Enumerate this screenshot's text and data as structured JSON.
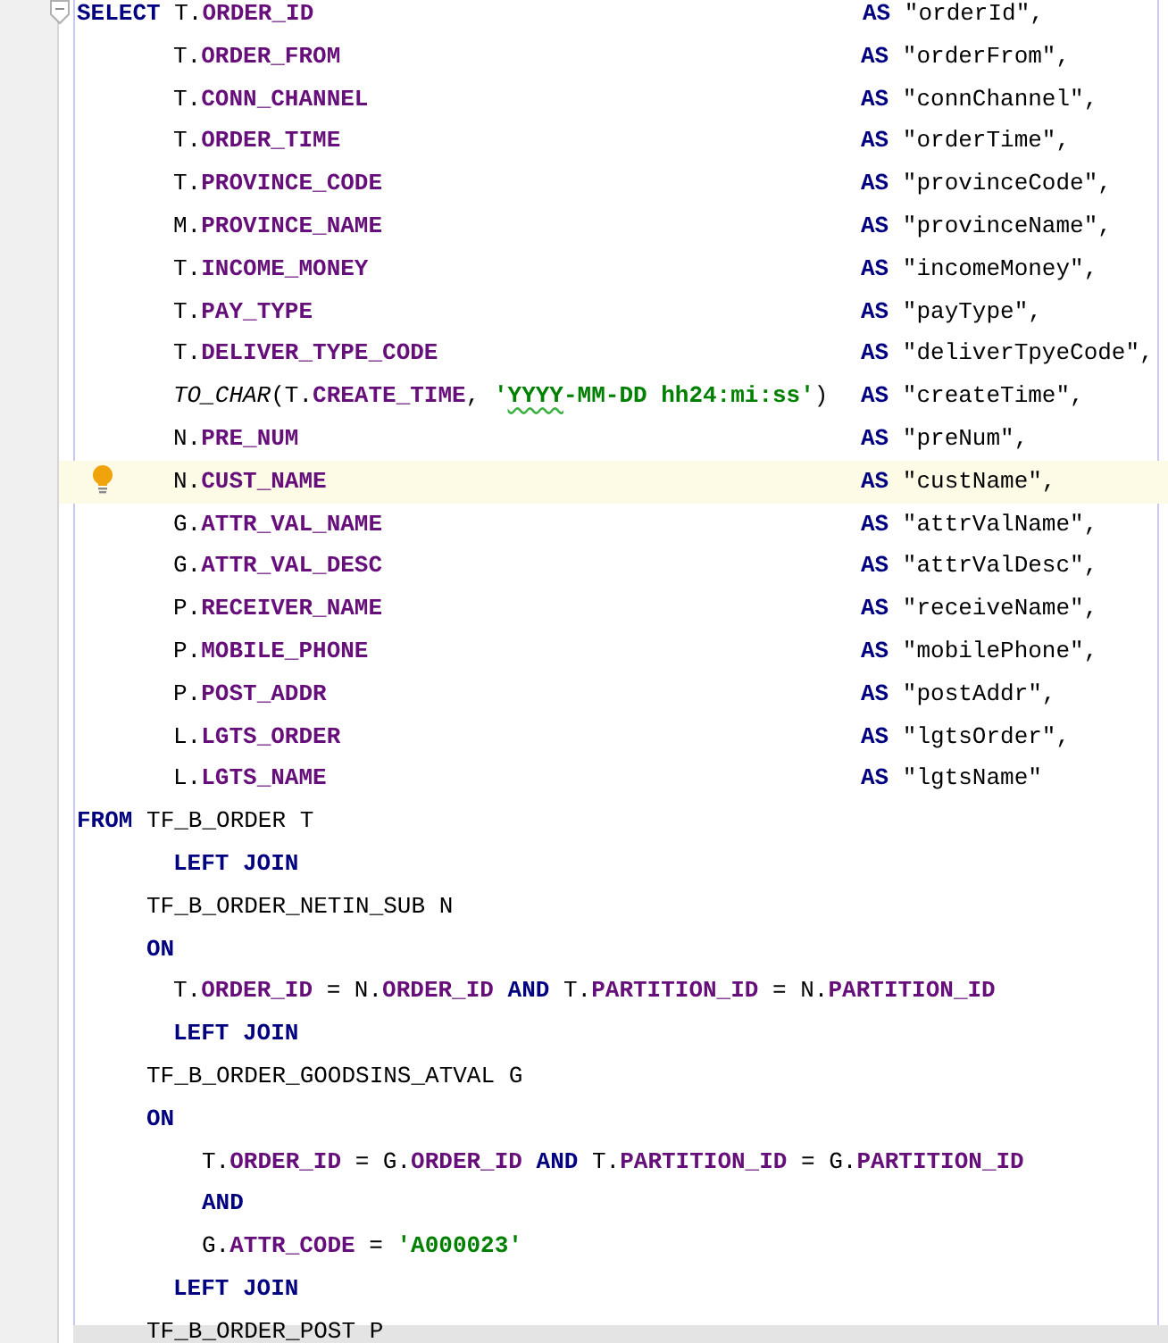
{
  "editor": {
    "lines": [
      {
        "kind": "clause",
        "fold": true,
        "current": false,
        "tokens": [
          {
            "t": "SELECT",
            "kind": "kw"
          },
          {
            "t": " T.",
            "kind": "plain"
          },
          {
            "t": "ORDER_ID",
            "kind": "col"
          }
        ],
        "alias": [
          {
            "t": "AS",
            "kind": "kw"
          },
          {
            "t": " \"orderId\",",
            "kind": "plain"
          }
        ]
      },
      {
        "kind": "column",
        "fold": false,
        "current": false,
        "tokens": [
          {
            "t": "T.",
            "kind": "plain"
          },
          {
            "t": "ORDER_FROM",
            "kind": "col"
          }
        ],
        "alias": [
          {
            "t": "AS",
            "kind": "kw"
          },
          {
            "t": " \"orderFrom\",",
            "kind": "plain"
          }
        ]
      },
      {
        "kind": "column",
        "fold": false,
        "current": false,
        "tokens": [
          {
            "t": "T.",
            "kind": "plain"
          },
          {
            "t": "CONN_CHANNEL",
            "kind": "col"
          }
        ],
        "alias": [
          {
            "t": "AS",
            "kind": "kw"
          },
          {
            "t": " \"connChannel\",",
            "kind": "plain"
          }
        ]
      },
      {
        "kind": "column",
        "fold": false,
        "current": false,
        "tokens": [
          {
            "t": "T.",
            "kind": "plain"
          },
          {
            "t": "ORDER_TIME",
            "kind": "col"
          }
        ],
        "alias": [
          {
            "t": "AS",
            "kind": "kw"
          },
          {
            "t": " \"orderTime\",",
            "kind": "plain"
          }
        ]
      },
      {
        "kind": "column",
        "fold": false,
        "current": false,
        "tokens": [
          {
            "t": "T.",
            "kind": "plain"
          },
          {
            "t": "PROVINCE_CODE",
            "kind": "col"
          }
        ],
        "alias": [
          {
            "t": "AS",
            "kind": "kw"
          },
          {
            "t": " \"provinceCode\",",
            "kind": "plain"
          }
        ]
      },
      {
        "kind": "column",
        "fold": false,
        "current": false,
        "tokens": [
          {
            "t": "M.",
            "kind": "plain"
          },
          {
            "t": "PROVINCE_NAME",
            "kind": "col"
          }
        ],
        "alias": [
          {
            "t": "AS",
            "kind": "kw"
          },
          {
            "t": " \"provinceName\",",
            "kind": "plain"
          }
        ]
      },
      {
        "kind": "column",
        "fold": false,
        "current": false,
        "tokens": [
          {
            "t": "T.",
            "kind": "plain"
          },
          {
            "t": "INCOME_MONEY",
            "kind": "col"
          }
        ],
        "alias": [
          {
            "t": "AS",
            "kind": "kw"
          },
          {
            "t": " \"incomeMoney\",",
            "kind": "plain"
          }
        ]
      },
      {
        "kind": "column",
        "fold": false,
        "current": false,
        "tokens": [
          {
            "t": "T.",
            "kind": "plain"
          },
          {
            "t": "PAY_TYPE",
            "kind": "col"
          }
        ],
        "alias": [
          {
            "t": "AS",
            "kind": "kw"
          },
          {
            "t": " \"payType\",",
            "kind": "plain"
          }
        ]
      },
      {
        "kind": "column",
        "fold": false,
        "current": false,
        "tokens": [
          {
            "t": "T.",
            "kind": "plain"
          },
          {
            "t": "DELIVER_TYPE_CODE",
            "kind": "col"
          }
        ],
        "alias": [
          {
            "t": "AS",
            "kind": "kw"
          },
          {
            "t": " \"deliverTpyeCode\",",
            "kind": "plain"
          }
        ]
      },
      {
        "kind": "column",
        "fold": false,
        "current": false,
        "tokens": [
          {
            "t": "TO_CHAR",
            "kind": "fn"
          },
          {
            "t": "(T.",
            "kind": "plain"
          },
          {
            "t": "CREATE_TIME",
            "kind": "col"
          },
          {
            "t": ", ",
            "kind": "plain"
          },
          {
            "t": "'",
            "kind": "str"
          },
          {
            "t": "YYYY",
            "kind": "str",
            "typo": true
          },
          {
            "t": "-MM-DD hh24:mi:ss'",
            "kind": "str"
          },
          {
            "t": ")",
            "kind": "plain"
          }
        ],
        "alias": [
          {
            "t": "AS",
            "kind": "kw"
          },
          {
            "t": " \"createTime\",",
            "kind": "plain"
          }
        ]
      },
      {
        "kind": "column",
        "fold": false,
        "current": false,
        "tokens": [
          {
            "t": "N.",
            "kind": "plain"
          },
          {
            "t": "PRE_NUM",
            "kind": "col"
          }
        ],
        "alias": [
          {
            "t": "AS",
            "kind": "kw"
          },
          {
            "t": " \"preNum\",",
            "kind": "plain"
          }
        ]
      },
      {
        "kind": "column",
        "fold": false,
        "current": true,
        "tokens": [
          {
            "t": "N.",
            "kind": "plain"
          },
          {
            "t": "CUST_NAME",
            "kind": "col"
          }
        ],
        "alias": [
          {
            "t": "AS",
            "kind": "kw"
          },
          {
            "t": " \"custName\",",
            "kind": "plain"
          }
        ]
      },
      {
        "kind": "column",
        "fold": false,
        "current": false,
        "tokens": [
          {
            "t": "G.",
            "kind": "plain"
          },
          {
            "t": "ATTR_VAL_NAME",
            "kind": "col"
          }
        ],
        "alias": [
          {
            "t": "AS",
            "kind": "kw"
          },
          {
            "t": " \"attrValName\",",
            "kind": "plain"
          }
        ]
      },
      {
        "kind": "column",
        "fold": false,
        "current": false,
        "tokens": [
          {
            "t": "G.",
            "kind": "plain"
          },
          {
            "t": "ATTR_VAL_DESC",
            "kind": "col"
          }
        ],
        "alias": [
          {
            "t": "AS",
            "kind": "kw"
          },
          {
            "t": " \"attrValDesc\",",
            "kind": "plain"
          }
        ]
      },
      {
        "kind": "column",
        "fold": false,
        "current": false,
        "tokens": [
          {
            "t": "P.",
            "kind": "plain"
          },
          {
            "t": "RECEIVER_NAME",
            "kind": "col"
          }
        ],
        "alias": [
          {
            "t": "AS",
            "kind": "kw"
          },
          {
            "t": " \"receiveName\",",
            "kind": "plain"
          }
        ]
      },
      {
        "kind": "column",
        "fold": false,
        "current": false,
        "tokens": [
          {
            "t": "P.",
            "kind": "plain"
          },
          {
            "t": "MOBILE_PHONE",
            "kind": "col"
          }
        ],
        "alias": [
          {
            "t": "AS",
            "kind": "kw"
          },
          {
            "t": " \"mobilePhone\",",
            "kind": "plain"
          }
        ]
      },
      {
        "kind": "column",
        "fold": false,
        "current": false,
        "tokens": [
          {
            "t": "P.",
            "kind": "plain"
          },
          {
            "t": "POST_ADDR",
            "kind": "col"
          }
        ],
        "alias": [
          {
            "t": "AS",
            "kind": "kw"
          },
          {
            "t": " \"postAddr\",",
            "kind": "plain"
          }
        ]
      },
      {
        "kind": "column",
        "fold": false,
        "current": false,
        "tokens": [
          {
            "t": "L.",
            "kind": "plain"
          },
          {
            "t": "LGTS_ORDER",
            "kind": "col"
          }
        ],
        "alias": [
          {
            "t": "AS",
            "kind": "kw"
          },
          {
            "t": " \"lgtsOrder\",",
            "kind": "plain"
          }
        ]
      },
      {
        "kind": "column",
        "fold": false,
        "current": false,
        "tokens": [
          {
            "t": "L.",
            "kind": "plain"
          },
          {
            "t": "LGTS_NAME",
            "kind": "col"
          }
        ],
        "alias": [
          {
            "t": "AS",
            "kind": "kw"
          },
          {
            "t": " \"lgtsName\"",
            "kind": "plain"
          }
        ]
      },
      {
        "kind": "clause",
        "fold": false,
        "current": false,
        "tokens": [
          {
            "t": "FROM",
            "kind": "kw"
          },
          {
            "t": " TF_B_ORDER T",
            "kind": "plain"
          }
        ]
      },
      {
        "kind": "join",
        "fold": false,
        "current": false,
        "tokens": [
          {
            "t": "LEFT JOIN",
            "kind": "kw"
          }
        ]
      },
      {
        "kind": "table",
        "fold": false,
        "current": false,
        "tokens": [
          {
            "t": "TF_B_ORDER_NETIN_SUB N",
            "kind": "plain"
          }
        ]
      },
      {
        "kind": "table",
        "fold": false,
        "current": false,
        "tokens": [
          {
            "t": "ON",
            "kind": "kw"
          }
        ]
      },
      {
        "kind": "join",
        "fold": false,
        "current": false,
        "tokens": [
          {
            "t": "T.",
            "kind": "plain"
          },
          {
            "t": "ORDER_ID",
            "kind": "col"
          },
          {
            "t": " = N.",
            "kind": "plain"
          },
          {
            "t": "ORDER_ID",
            "kind": "col"
          },
          {
            "t": " AND",
            "kind": "kw"
          },
          {
            "t": " T.",
            "kind": "plain"
          },
          {
            "t": "PARTITION_ID",
            "kind": "col"
          },
          {
            "t": " = N.",
            "kind": "plain"
          },
          {
            "t": "PARTITION_ID",
            "kind": "col"
          }
        ]
      },
      {
        "kind": "join",
        "fold": false,
        "current": false,
        "tokens": [
          {
            "t": "LEFT JOIN",
            "kind": "kw"
          }
        ]
      },
      {
        "kind": "table",
        "fold": false,
        "current": false,
        "tokens": [
          {
            "t": "TF_B_ORDER_GOODSINS_ATVAL G",
            "kind": "plain"
          }
        ]
      },
      {
        "kind": "table",
        "fold": false,
        "current": false,
        "tokens": [
          {
            "t": "ON",
            "kind": "kw"
          }
        ]
      },
      {
        "kind": "nested",
        "fold": false,
        "current": false,
        "tokens": [
          {
            "t": "T.",
            "kind": "plain"
          },
          {
            "t": "ORDER_ID",
            "kind": "col"
          },
          {
            "t": " = G.",
            "kind": "plain"
          },
          {
            "t": "ORDER_ID",
            "kind": "col"
          },
          {
            "t": " AND",
            "kind": "kw"
          },
          {
            "t": " T.",
            "kind": "plain"
          },
          {
            "t": "PARTITION_ID",
            "kind": "col"
          },
          {
            "t": " = G.",
            "kind": "plain"
          },
          {
            "t": "PARTITION_ID",
            "kind": "col"
          }
        ]
      },
      {
        "kind": "nested",
        "fold": false,
        "current": false,
        "tokens": [
          {
            "t": "AND",
            "kind": "kw"
          }
        ]
      },
      {
        "kind": "nested",
        "fold": false,
        "current": false,
        "tokens": [
          {
            "t": "G.",
            "kind": "plain"
          },
          {
            "t": "ATTR_CODE",
            "kind": "col"
          },
          {
            "t": " = ",
            "kind": "plain"
          },
          {
            "t": "'A000023'",
            "kind": "str"
          }
        ]
      },
      {
        "kind": "join",
        "fold": false,
        "current": false,
        "tokens": [
          {
            "t": "LEFT JOIN",
            "kind": "kw"
          }
        ]
      },
      {
        "kind": "table",
        "fold": false,
        "current": false,
        "tokens": [
          {
            "t": "TF_B_ORDER_POST P",
            "kind": "plain"
          }
        ]
      }
    ]
  }
}
